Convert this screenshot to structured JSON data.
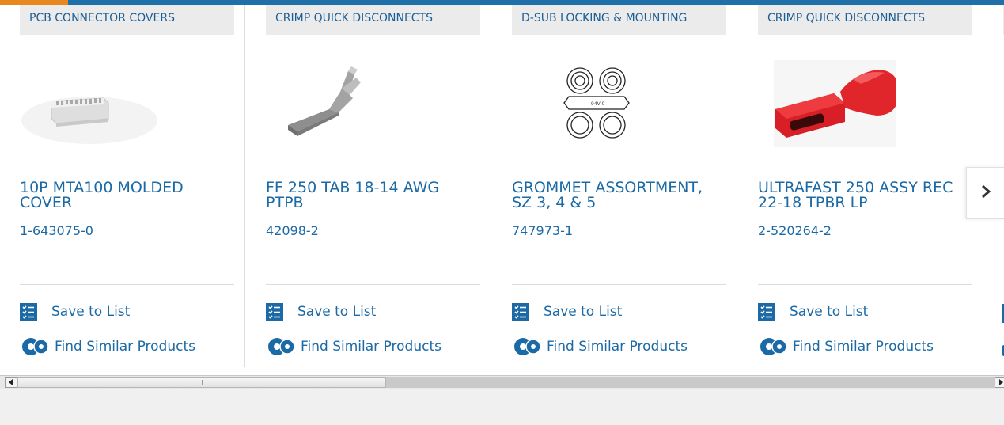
{
  "carousel": {
    "products": [
      {
        "category": "PCB CONNECTOR COVERS",
        "name_line1": "10P MTA100 MOLDED",
        "name_line2": "COVER",
        "part_number": "1-643075-0",
        "save_label": "Save to List",
        "similar_label": "Find Similar Products",
        "image": "white-connector-cover-image"
      },
      {
        "category": "CRIMP QUICK DISCONNECTS",
        "name_line1": "FF 250 TAB 18-14 AWG",
        "name_line2": "PTPB",
        "part_number": "42098-2",
        "save_label": "Save to List",
        "similar_label": "Find Similar Products",
        "image": "metal-tab-terminal-image"
      },
      {
        "category": "D-SUB LOCKING & MOUNTING",
        "name_line1": "GROMMET ASSORTMENT,",
        "name_line2": "SZ 3, 4 & 5",
        "part_number": "747973-1",
        "save_label": "Save to List",
        "similar_label": "Find Similar Products",
        "image": "grommet-drawing-image"
      },
      {
        "category": "CRIMP QUICK DISCONNECTS",
        "name_line1": "ULTRAFAST 250 ASSY REC",
        "name_line2": "22-18 TPBR LP",
        "part_number": "2-520264-2",
        "save_label": "Save to List",
        "similar_label": "Find Similar Products",
        "image": "red-receptacle-image"
      }
    ],
    "next_icon": "chevron-right-icon"
  },
  "colors": {
    "link": "#1b6aa6",
    "category_bg": "#ebebeb",
    "top_bar": "#1f6fa8",
    "top_accent": "#e8871e",
    "red_part": "#d81e26"
  }
}
